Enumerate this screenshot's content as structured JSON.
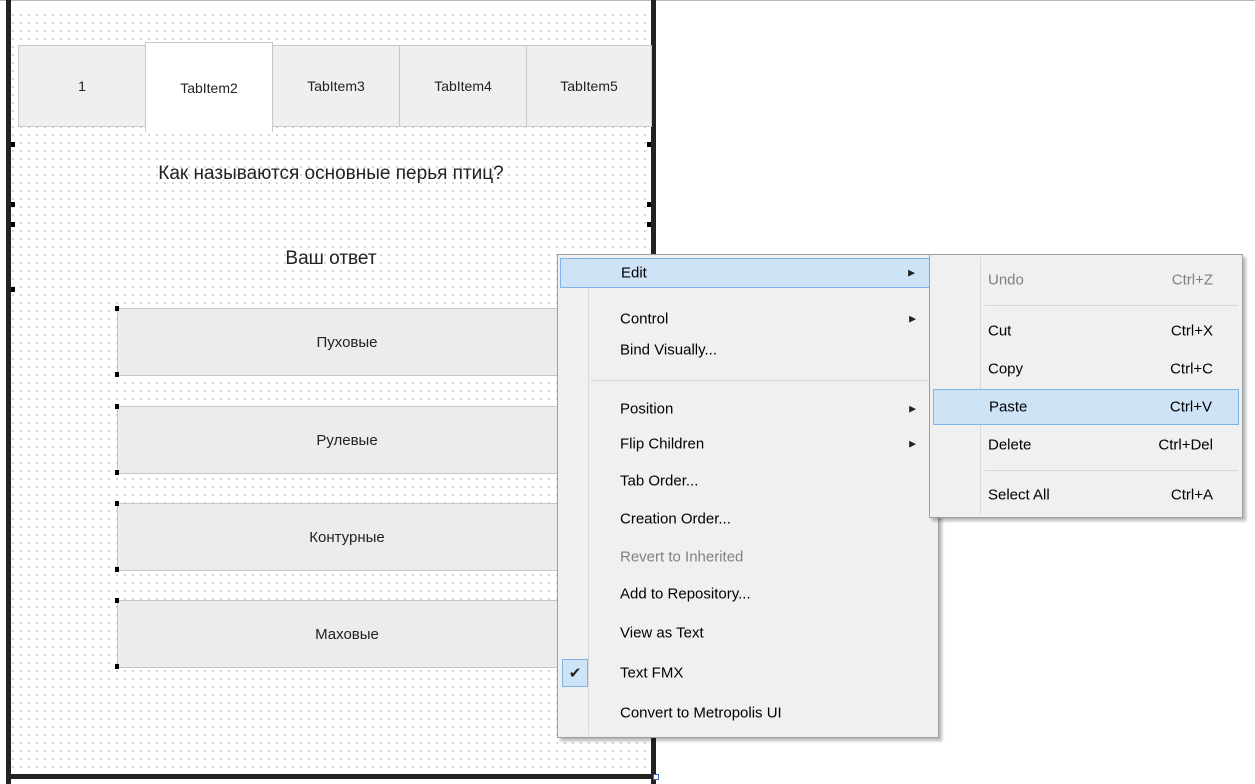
{
  "tabs": [
    "1",
    "TabItem2",
    "TabItem3",
    "TabItem4",
    "TabItem5"
  ],
  "question": "Как называются основные перья птиц?",
  "answer_label": "Ваш ответ",
  "answers": [
    "Пуховые",
    "Рулевые",
    "Контурные",
    "Маховые"
  ],
  "context_menu": {
    "edit": "Edit",
    "control": "Control",
    "bind_visually": "Bind Visually...",
    "position": "Position",
    "flip_children": "Flip Children",
    "tab_order": "Tab Order...",
    "creation_order": "Creation Order...",
    "revert_to_inherited": "Revert to Inherited",
    "add_to_repository": "Add to Repository...",
    "view_as_text": "View as Text",
    "text_fmx": "Text FMX",
    "convert_to_metropolis": "Convert to Metropolis UI",
    "text_fmx_checked": true
  },
  "edit_submenu": {
    "undo": {
      "label": "Undo",
      "shortcut": "Ctrl+Z"
    },
    "cut": {
      "label": "Cut",
      "shortcut": "Ctrl+X"
    },
    "copy": {
      "label": "Copy",
      "shortcut": "Ctrl+C"
    },
    "paste": {
      "label": "Paste",
      "shortcut": "Ctrl+V"
    },
    "delete": {
      "label": "Delete",
      "shortcut": "Ctrl+Del"
    },
    "select_all": {
      "label": "Select All",
      "shortcut": "Ctrl+A"
    }
  },
  "icons": {
    "submenu_arrow": "submenu-arrow-icon",
    "check": "check-icon"
  },
  "colors": {
    "highlight": "#cfe3f7",
    "highlight_border": "#7eb4ea",
    "disabled_text": "#808080"
  }
}
